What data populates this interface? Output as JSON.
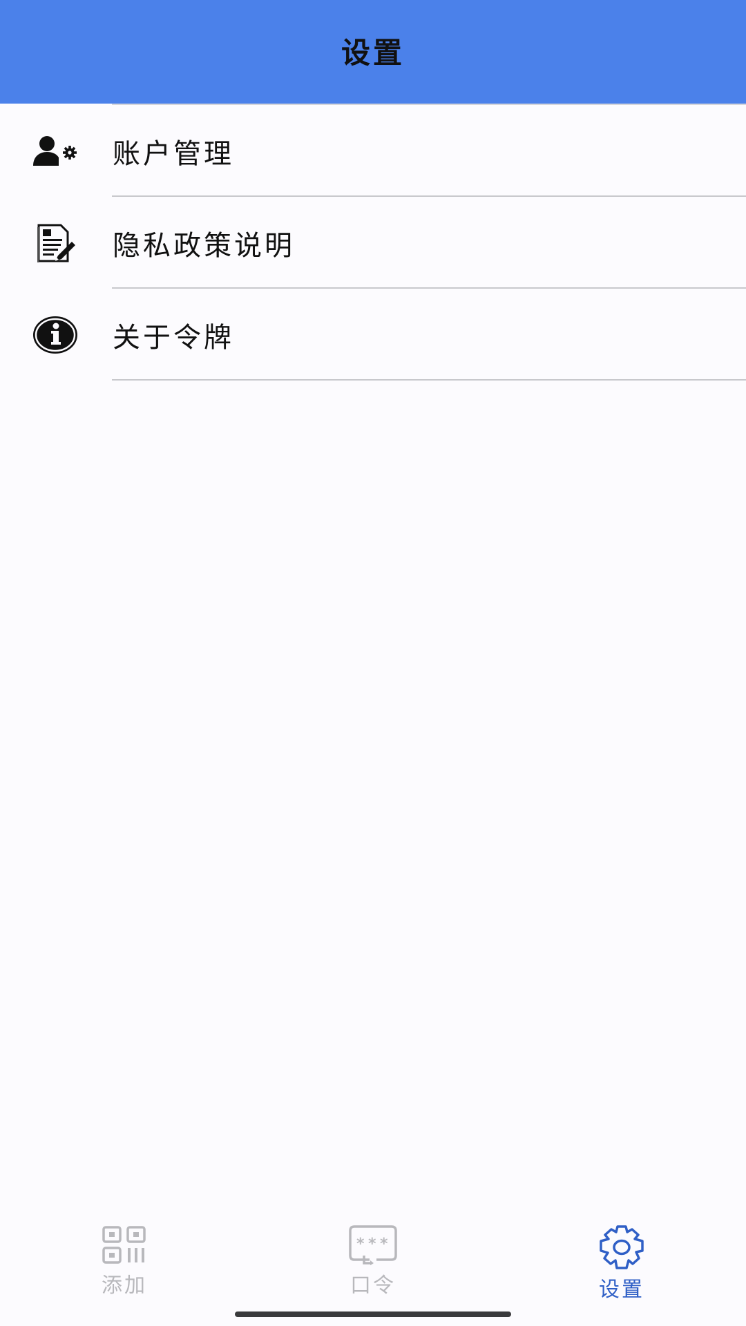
{
  "header": {
    "title": "设置"
  },
  "menu": {
    "items": [
      {
        "label": "账户管理",
        "icon": "user-settings-icon"
      },
      {
        "label": "隐私政策说明",
        "icon": "document-edit-icon"
      },
      {
        "label": "关于令牌",
        "icon": "info-icon"
      }
    ]
  },
  "tabbar": {
    "tabs": [
      {
        "label": "添加",
        "icon": "qr-code-icon",
        "active": false
      },
      {
        "label": "口令",
        "icon": "password-icon",
        "active": false
      },
      {
        "label": "设置",
        "icon": "gear-icon",
        "active": true
      }
    ]
  },
  "colors": {
    "header_bg": "#4b81ea",
    "active_tab": "#2f5fc6",
    "inactive_tab": "#b8b8bc",
    "page_bg": "#fcfbfe"
  }
}
